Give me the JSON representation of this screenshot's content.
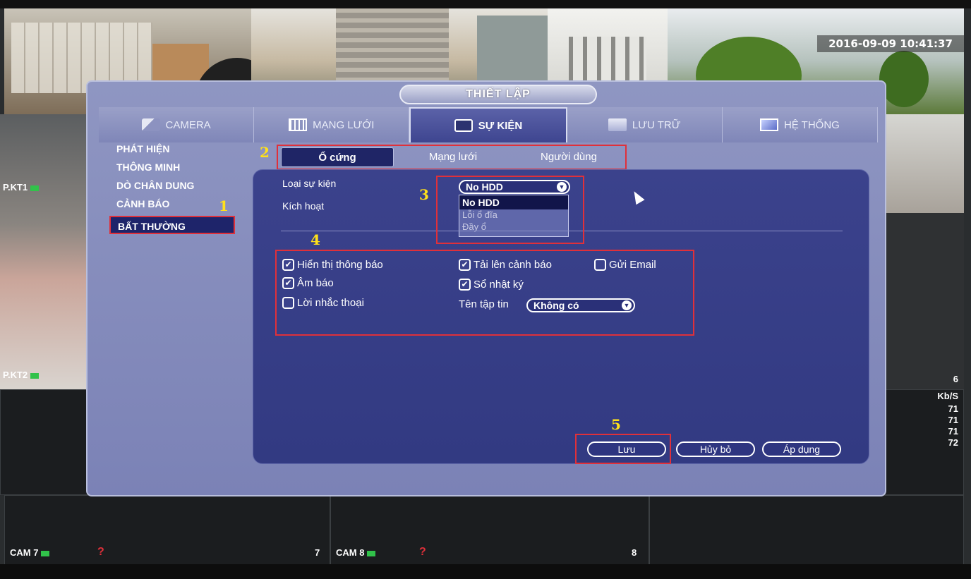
{
  "osd": {
    "timestamp": "2016-09-09 10:41:37",
    "cam_label_kt1": "P.KT1",
    "cam_label_kt2": "P.KT2",
    "cam7_label": "CAM 7",
    "cam7_num": "7",
    "cam8_label": "CAM 8",
    "cam8_num": "8",
    "side_six": "6",
    "bitrate_unit": "Kb/S",
    "bitrate_values": [
      "71",
      "71",
      "71",
      "72"
    ]
  },
  "dialog": {
    "title": "THIẾT LẬP",
    "tabs": [
      {
        "label": "CAMERA",
        "icon": "camera-icon"
      },
      {
        "label": "MẠNG LƯỚI",
        "icon": "network-icon"
      },
      {
        "label": "SỰ KIỆN",
        "icon": "event-icon"
      },
      {
        "label": "LƯU TRỮ",
        "icon": "storage-icon"
      },
      {
        "label": "HỆ THỐNG",
        "icon": "system-icon"
      }
    ],
    "active_tab": "SỰ KIỆN"
  },
  "sidebar": {
    "items": [
      "PHÁT HIỆN",
      "THÔNG MINH",
      "DÒ CHÂN DUNG",
      "CẢNH BÁO",
      "BẤT THƯỜNG"
    ],
    "active": "BẤT THƯỜNG"
  },
  "subtabs": {
    "items": [
      "Ổ cứng",
      "Mạng lưới",
      "Người dùng"
    ],
    "active": "Ổ cứng"
  },
  "form": {
    "event_type_label": "Loại sự kiện",
    "enable_label": "Kích hoạt",
    "event_type_value": "No HDD",
    "event_type_options": [
      "No HDD",
      "Lỗi ổ đĩa",
      "Đầy ổ"
    ],
    "show_message_label": "Hiển thị thông báo",
    "show_message_checked": true,
    "buzzer_label": "Âm báo",
    "buzzer_checked": true,
    "voice_prompt_label": "Lời nhắc thoại",
    "voice_prompt_checked": false,
    "alarm_upload_label": "Tải lên cảnh báo",
    "alarm_upload_checked": true,
    "send_email_label": "Gửi Email",
    "send_email_checked": false,
    "log_label": "Sổ nhật ký",
    "log_checked": true,
    "file_name_label": "Tên tập tin",
    "file_name_value": "Không có"
  },
  "buttons": {
    "save": "Lưu",
    "cancel": "Hủy bỏ",
    "apply": "Áp dụng"
  },
  "annotations": [
    "1",
    "2",
    "3",
    "4",
    "5"
  ],
  "colors": {
    "dialog_bg": "#7b82b6",
    "panel_bg": "#3b428c",
    "annotation_box": "#e0303a",
    "annotation_number": "#ffe11a"
  }
}
